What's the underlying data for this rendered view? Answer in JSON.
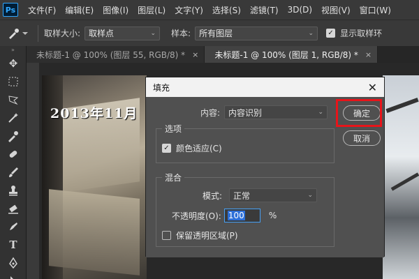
{
  "app": {
    "logo": "Ps"
  },
  "menu": [
    "文件(F)",
    "编辑(E)",
    "图像(I)",
    "图层(L)",
    "文字(Y)",
    "选择(S)",
    "滤镜(T)",
    "3D(D)",
    "视图(V)",
    "窗口(W)"
  ],
  "options": {
    "sample_size_label": "取样大小:",
    "sample_size_value": "取样点",
    "sample_label": "样本:",
    "sample_value": "所有图层",
    "show_ring_label": "显示取样环",
    "show_ring_checked": true
  },
  "tabs": [
    {
      "label": "未标题-1 @ 100% (图层 55, RGB/8) *",
      "active": false
    },
    {
      "label": "未标题-1 @ 100% (图层 1, RGB/8) *",
      "active": true
    }
  ],
  "tab_close": "×",
  "canvas": {
    "timestamp_text": "2013年11月"
  },
  "dialog": {
    "title": "填充",
    "close": "✕",
    "content_label": "内容:",
    "content_value": "内容识别",
    "ok": "确定",
    "cancel": "取消",
    "options_group": "选项",
    "color_adapt_label": "颜色适应(C)",
    "color_adapt_checked": true,
    "blend_group": "混合",
    "mode_label": "模式:",
    "mode_value": "正常",
    "opacity_label": "不透明度(O):",
    "opacity_value": "100",
    "opacity_unit": "%",
    "preserve_label": "保留透明区域(P)",
    "preserve_checked": false
  },
  "colors": {
    "highlight": "#e8141a",
    "ps_accent": "#31a8ff",
    "selection": "#2d6fd8"
  }
}
